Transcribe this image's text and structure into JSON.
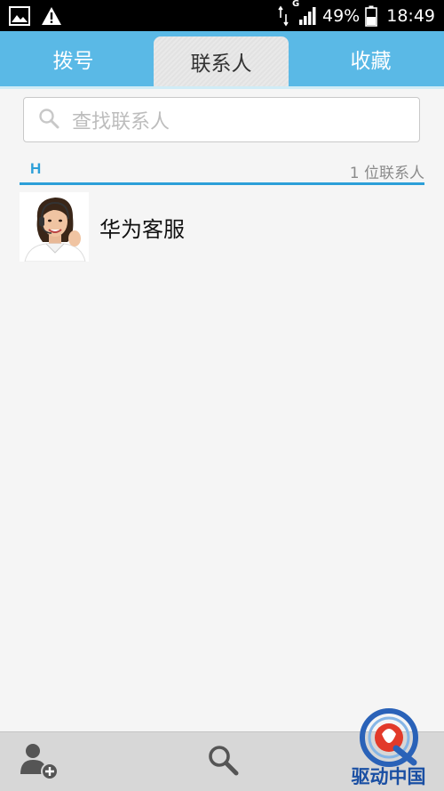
{
  "status_bar": {
    "battery_percent": "49%",
    "time": "18:49",
    "network_label": "G",
    "icons": [
      "image-icon",
      "warning-icon",
      "sync-arrows-icon",
      "signal-icon",
      "battery-icon"
    ]
  },
  "tabs": [
    {
      "label": "拨号",
      "active": false
    },
    {
      "label": "联系人",
      "active": true
    },
    {
      "label": "收藏",
      "active": false
    }
  ],
  "search": {
    "placeholder": "查找联系人"
  },
  "contacts": {
    "section_letter": "H",
    "count_label": "1 位联系人",
    "items": [
      {
        "name": "华为客服",
        "avatar": "customer-service-avatar"
      }
    ]
  },
  "bottom_bar": {
    "icons": [
      "add-contact-icon",
      "search-icon"
    ]
  },
  "watermark": {
    "text": "驱动中国"
  },
  "colors": {
    "accent": "#5ab9e6",
    "section_blue": "#2c9fd8"
  }
}
